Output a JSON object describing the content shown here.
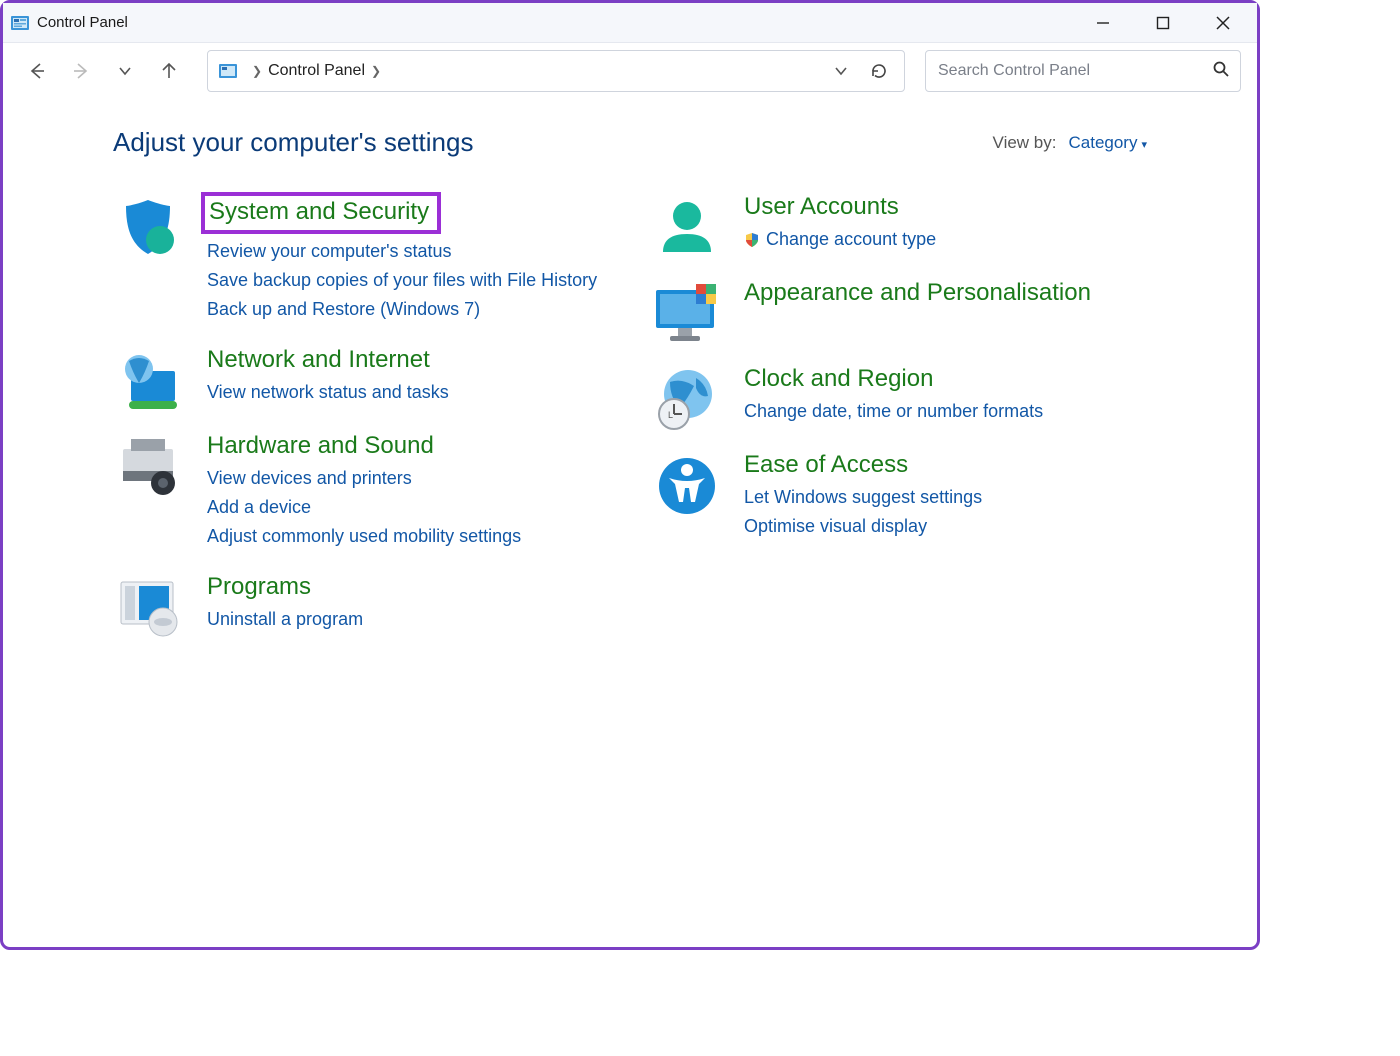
{
  "window": {
    "title": "Control Panel"
  },
  "address": {
    "crumb": "Control Panel"
  },
  "search": {
    "placeholder": "Search Control Panel"
  },
  "heading": "Adjust your computer's settings",
  "viewby": {
    "label": "View by:",
    "value": "Category"
  },
  "cats": {
    "system": {
      "title": "System and Security",
      "l1": "Review your computer's status",
      "l2": "Save backup copies of your files with File History",
      "l3": "Back up and Restore (Windows 7)"
    },
    "network": {
      "title": "Network and Internet",
      "l1": "View network status and tasks"
    },
    "hardware": {
      "title": "Hardware and Sound",
      "l1": "View devices and printers",
      "l2": "Add a device",
      "l3": "Adjust commonly used mobility settings"
    },
    "programs": {
      "title": "Programs",
      "l1": "Uninstall a program"
    },
    "user": {
      "title": "User Accounts",
      "l1": "Change account type"
    },
    "appearance": {
      "title": "Appearance and Personalisation"
    },
    "clock": {
      "title": "Clock and Region",
      "l1": "Change date, time or number formats"
    },
    "ease": {
      "title": "Ease of Access",
      "l1": "Let Windows suggest settings",
      "l2": "Optimise visual display"
    }
  }
}
